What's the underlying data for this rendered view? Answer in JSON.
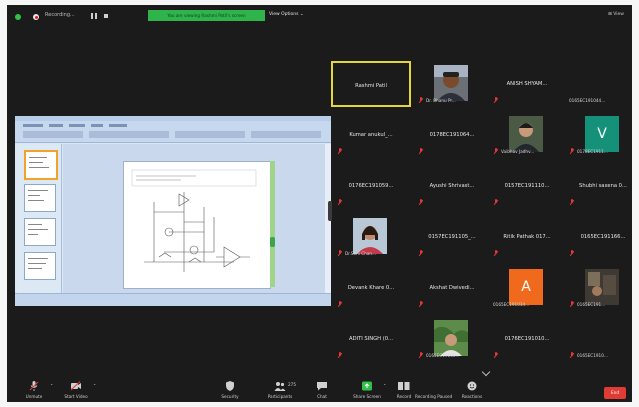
{
  "topbar": {
    "recording_label": "Recording...",
    "share_banner": "You are viewing Rashmi Patil's screen",
    "view_options": "View Options ⌄",
    "view_button": "⊞ View"
  },
  "gallery": [
    {
      "name": "Rashmi Patil",
      "label": "",
      "muted": false,
      "photo": false,
      "active": true
    },
    {
      "name": "",
      "label": "Dr. Bhanu Pr...",
      "muted": true,
      "photo": true,
      "photo_kind": "man",
      "active": false
    },
    {
      "name": "ANISH SHYAM...",
      "label": "",
      "muted": true,
      "photo": false,
      "active": false
    },
    {
      "name": "",
      "label": "0165EC191044...",
      "muted": false,
      "photo": false,
      "active": false
    },
    {
      "name": "Kumar anukul_...",
      "label": "",
      "muted": true,
      "photo": false,
      "active": false
    },
    {
      "name": "0178EC191064...",
      "label": "",
      "muted": true,
      "photo": false,
      "active": false
    },
    {
      "name": "",
      "label": "Vaibhav Jadhv...",
      "muted": true,
      "photo": true,
      "photo_kind": "person-dark",
      "active": false
    },
    {
      "name": "",
      "label": "0178EC1911...",
      "muted": true,
      "photo": false,
      "avatar_letter": "V",
      "avatar_color": "#15917a",
      "active": false
    },
    {
      "name": "0176EC191059...",
      "label": "",
      "muted": true,
      "photo": false,
      "active": false
    },
    {
      "name": "Ayushi Shrivast...",
      "label": "",
      "muted": true,
      "photo": false,
      "active": false
    },
    {
      "name": "0157EC191110...",
      "label": "",
      "muted": true,
      "photo": false,
      "active": false
    },
    {
      "name": "Shubhi saxena 0...",
      "label": "",
      "muted": true,
      "photo": false,
      "active": false
    },
    {
      "name": "",
      "label": "Dr.Soni Chan...",
      "muted": true,
      "photo": true,
      "photo_kind": "woman",
      "active": false
    },
    {
      "name": "0157EC191105_...",
      "label": "",
      "muted": true,
      "photo": false,
      "active": false
    },
    {
      "name": "Ritik Pathak 017...",
      "label": "",
      "muted": true,
      "photo": false,
      "active": false
    },
    {
      "name": "0165EC191166...",
      "label": "",
      "muted": true,
      "photo": false,
      "active": false
    },
    {
      "name": "Devank Khare 0...",
      "label": "",
      "muted": true,
      "photo": false,
      "active": false
    },
    {
      "name": "Akshat Dwivedi...",
      "label": "",
      "muted": true,
      "photo": false,
      "active": false
    },
    {
      "name": "",
      "label": "0165EC191034...",
      "muted": false,
      "photo": false,
      "avatar_letter": "A",
      "avatar_color": "#f06a1e",
      "active": false
    },
    {
      "name": "",
      "label": "0165EC191...",
      "muted": true,
      "photo": true,
      "photo_kind": "room",
      "active": false
    },
    {
      "name": "ADITI SINGH (0...",
      "label": "",
      "muted": true,
      "photo": false,
      "active": false
    },
    {
      "name": "",
      "label": "0165EC19100...",
      "muted": true,
      "photo": true,
      "photo_kind": "plants",
      "active": false
    },
    {
      "name": "0176EC191010...",
      "label": "",
      "muted": true,
      "photo": false,
      "active": false
    },
    {
      "name": "",
      "label": "0165EC1910...",
      "muted": true,
      "photo": false,
      "active": false
    }
  ],
  "toolbar": {
    "unmute": "Unmute",
    "start_video": "Start Video",
    "security": "Security",
    "participants": "Participants",
    "participants_count": "275",
    "chat": "Chat",
    "share_screen": "Share Screen",
    "record": "Record",
    "record_paused": "Recording Paused",
    "reactions": "Reactions",
    "end": "End"
  },
  "colors": {
    "background": "#1b1b1b",
    "share_green": "#2fb34b",
    "active_speaker": "#e6d63e",
    "muted_red": "#e23838",
    "end_red": "#e13b35"
  }
}
